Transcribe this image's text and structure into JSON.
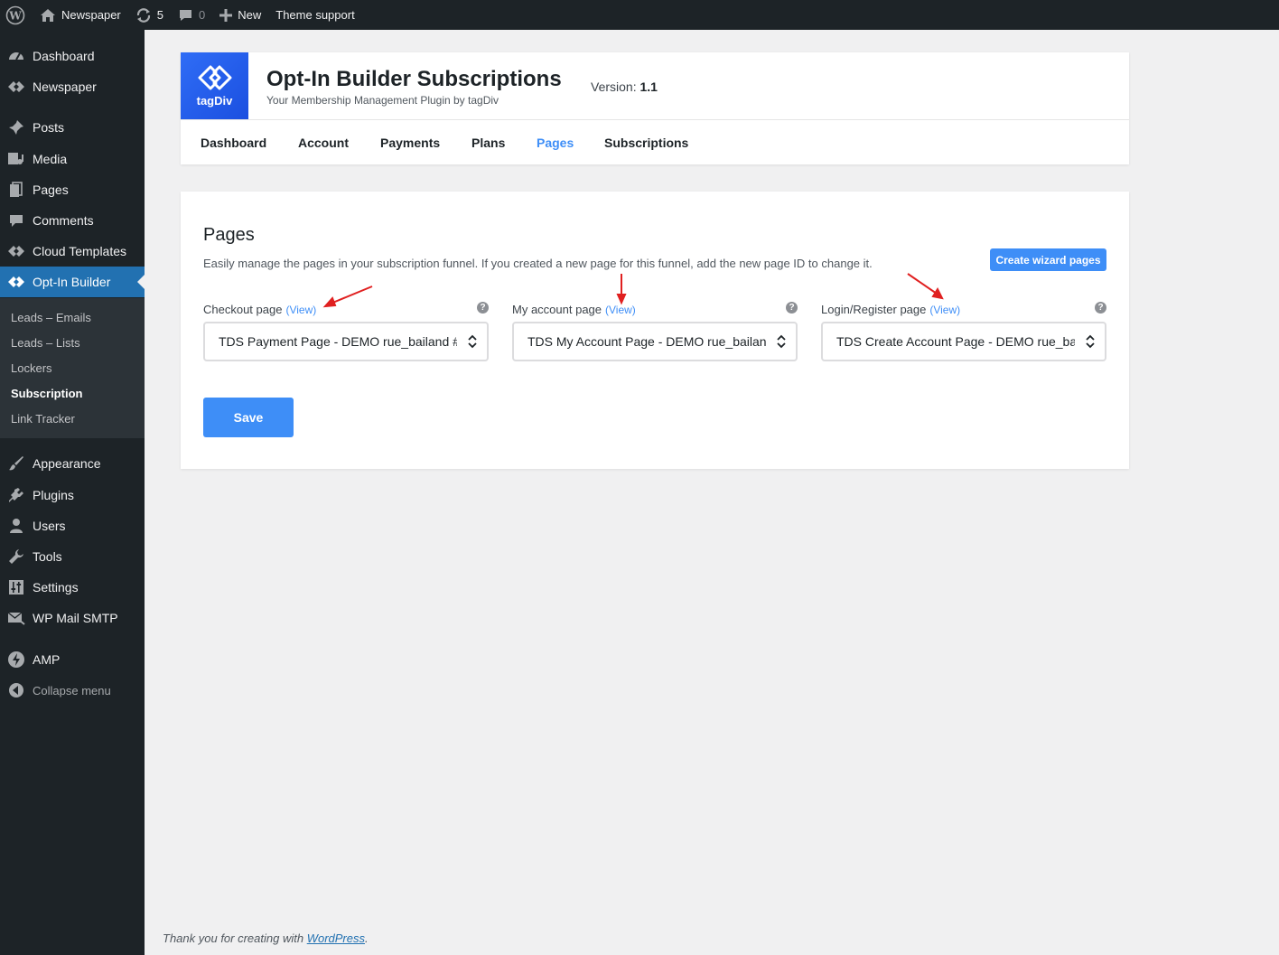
{
  "adminbar": {
    "site_name": "Newspaper",
    "updates_count": "5",
    "comments_count": "0",
    "new_label": "New",
    "theme_support": "Theme support"
  },
  "sidebar": {
    "items": [
      {
        "label": "Dashboard",
        "icon": "dashboard-icon"
      },
      {
        "label": "Newspaper",
        "icon": "tagdiv-icon"
      },
      {
        "label": "Posts",
        "icon": "pin-icon"
      },
      {
        "label": "Media",
        "icon": "media-icon"
      },
      {
        "label": "Pages",
        "icon": "pages-icon"
      },
      {
        "label": "Comments",
        "icon": "comment-icon"
      },
      {
        "label": "Cloud Templates",
        "icon": "tagdiv-icon"
      },
      {
        "label": "Opt-In Builder",
        "icon": "tagdiv-icon"
      },
      {
        "label": "Appearance",
        "icon": "brush-icon"
      },
      {
        "label": "Plugins",
        "icon": "plug-icon"
      },
      {
        "label": "Users",
        "icon": "user-icon"
      },
      {
        "label": "Tools",
        "icon": "wrench-icon"
      },
      {
        "label": "Settings",
        "icon": "sliders-icon"
      },
      {
        "label": "WP Mail SMTP",
        "icon": "mail-icon"
      },
      {
        "label": "AMP",
        "icon": "bolt-icon"
      }
    ],
    "submenu": [
      "Leads – Emails",
      "Leads – Lists",
      "Lockers",
      "Subscription",
      "Link Tracker"
    ],
    "collapse_label": "Collapse menu"
  },
  "header": {
    "logo_text": "tagDiv",
    "title": "Opt-In Builder Subscriptions",
    "subtitle": "Your Membership Management Plugin by tagDiv",
    "version_label": "Version:",
    "version_value": "1.1",
    "tabs": [
      "Dashboard",
      "Account",
      "Payments",
      "Plans",
      "Pages",
      "Subscriptions"
    ]
  },
  "main": {
    "title": "Pages",
    "description": "Easily manage the pages in your subscription funnel. If you created a new page for this funnel, add the new page ID to change it.",
    "wizard_button": "Create wizard pages",
    "view_link": "(View)",
    "help_glyph": "?",
    "fields": [
      {
        "label": "Checkout page",
        "value": "TDS Payment Page - DEMO rue_bailand #"
      },
      {
        "label": "My account page",
        "value": "TDS My Account Page - DEMO rue_bailan"
      },
      {
        "label": "Login/Register page",
        "value": "TDS Create Account Page - DEMO rue_bai"
      }
    ],
    "save_button": "Save"
  },
  "footer": {
    "text": "Thank you for creating with",
    "link": "WordPress",
    "suffix": "."
  },
  "colors": {
    "accent": "#3e8ef7",
    "admin_dark": "#1d2327",
    "current_menu": "#2271b1",
    "annotation_arrow": "#e02020"
  }
}
